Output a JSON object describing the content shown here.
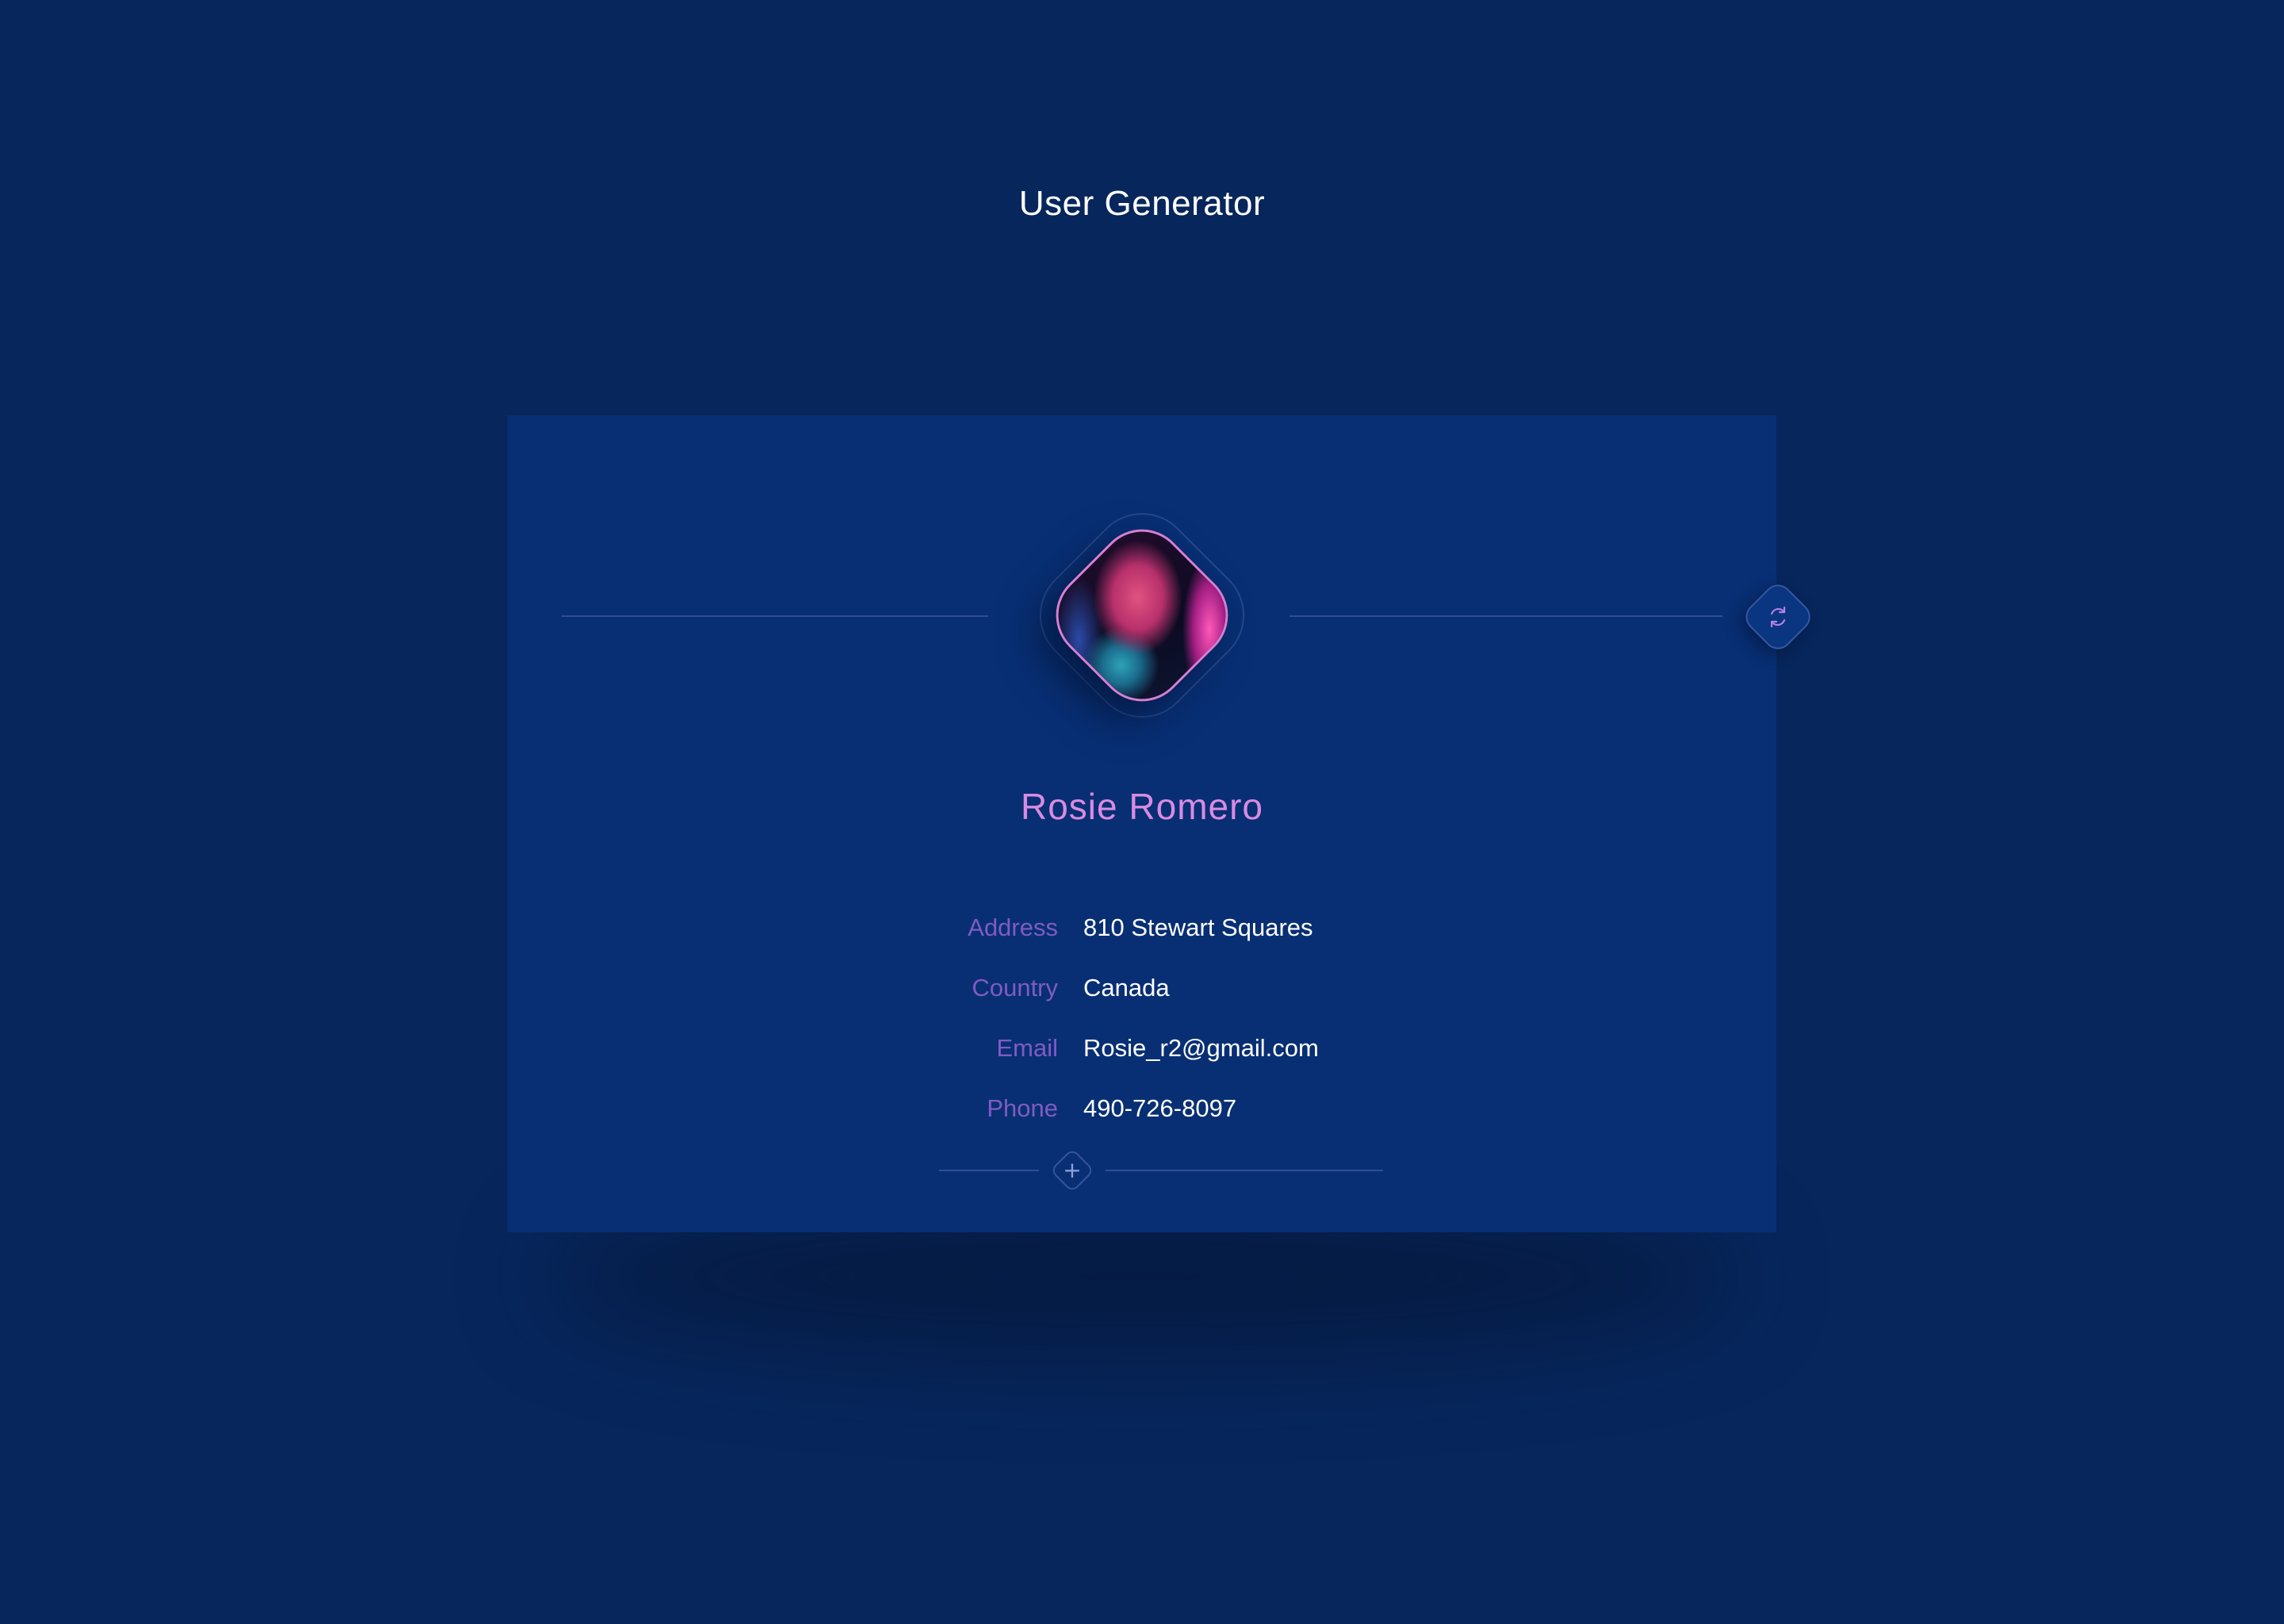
{
  "page": {
    "title": "User Generator"
  },
  "user": {
    "name": "Rosie Romero",
    "avatar_icon": "user-photo"
  },
  "details": [
    {
      "label": "Address",
      "value": "810 Stewart Squares"
    },
    {
      "label": "Country",
      "value": "Canada"
    },
    {
      "label": "Email",
      "value": "Rosie_r2@gmail.com"
    },
    {
      "label": "Phone",
      "value": "490-726-8097"
    }
  ],
  "controls": {
    "refresh_icon": "refresh-icon",
    "add_symbol": "+"
  },
  "colors": {
    "background": "#07265c",
    "card": "#082f74",
    "accent_name": "#d98be0",
    "label": "#7f5bc2",
    "value": "#ffffff"
  }
}
